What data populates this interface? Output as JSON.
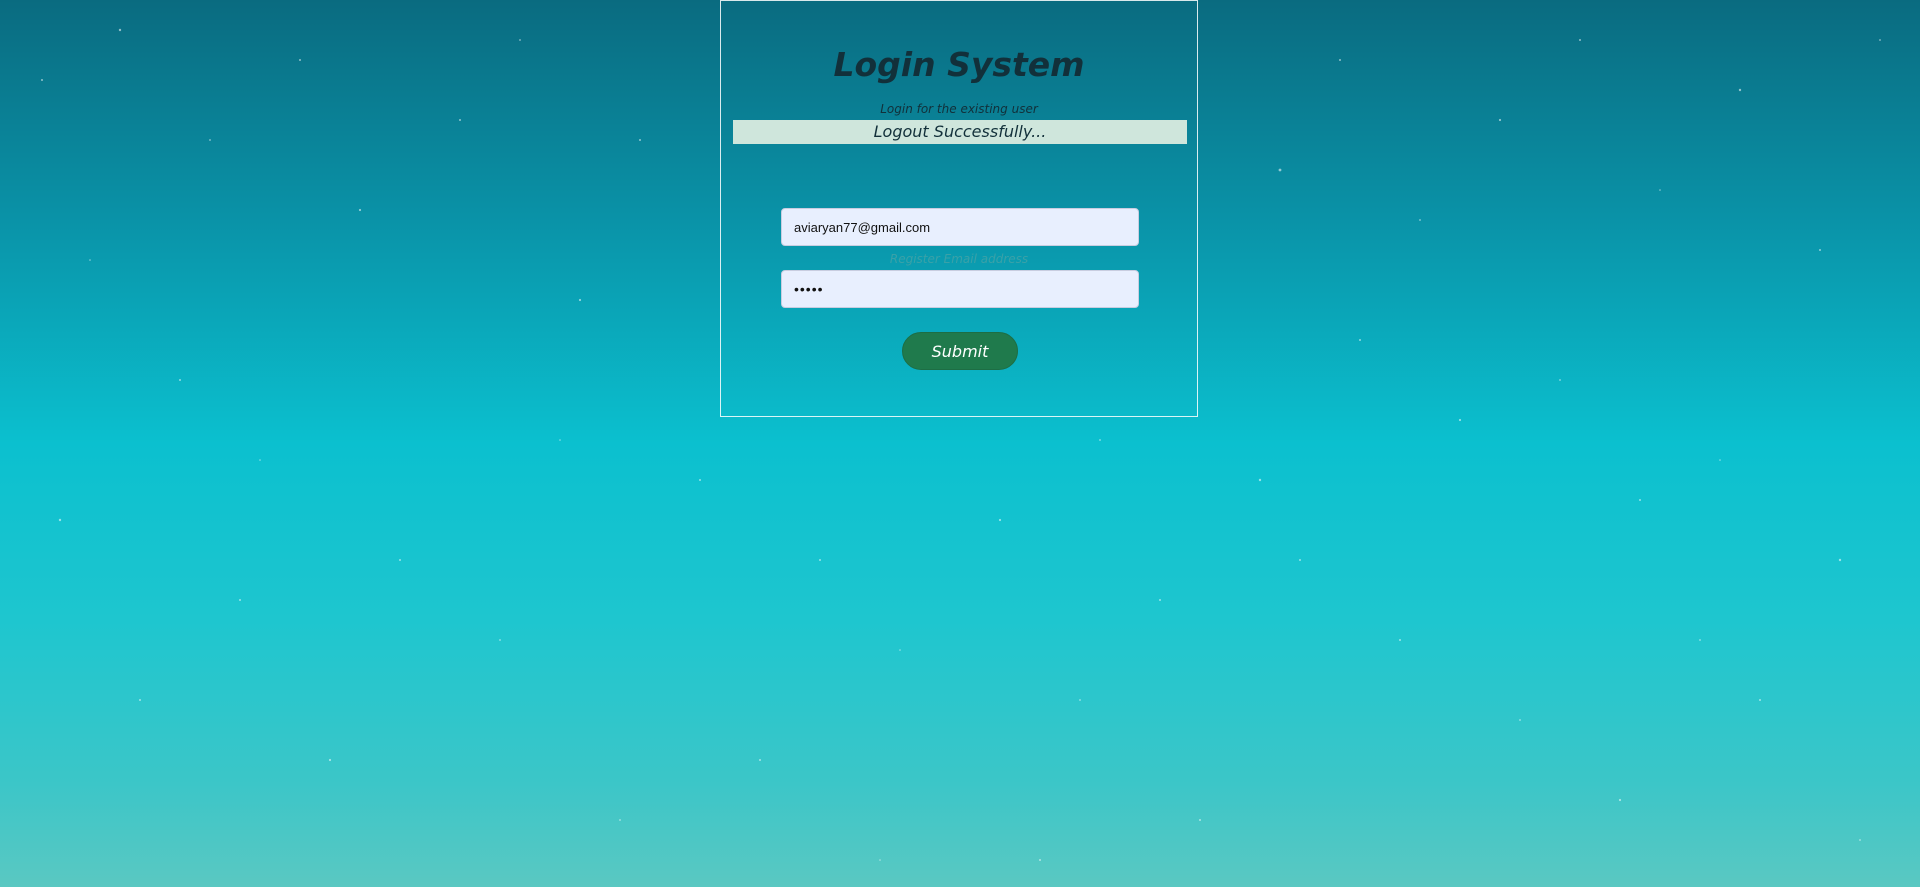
{
  "login": {
    "title": "Login System",
    "subtitle": "Login for the existing user",
    "alert_message": "Logout Successfully...",
    "email_value": "aviaryan77@gmail.com",
    "password_value": "•••••",
    "hint_text": "Register Email address",
    "submit_label": "Submit"
  },
  "colors": {
    "submit_bg": "#1f7a4c",
    "alert_bg": "#cfe6dc",
    "input_bg": "#e8effe"
  }
}
